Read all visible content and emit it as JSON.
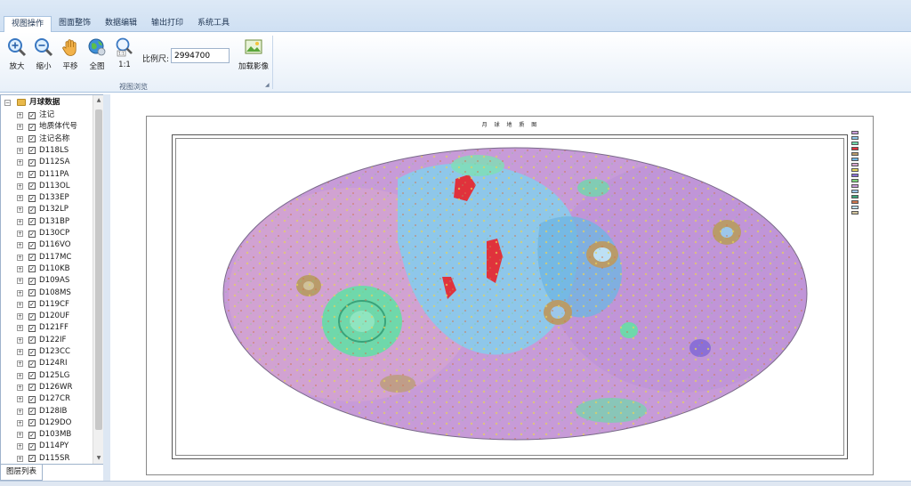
{
  "tabs": [
    "视图操作",
    "图面整饰",
    "数据编辑",
    "输出打印",
    "系统工具"
  ],
  "active_tab": 0,
  "ribbon": {
    "buttons": [
      {
        "label": "放大",
        "icon": "zoom-in-icon"
      },
      {
        "label": "缩小",
        "icon": "zoom-out-icon"
      },
      {
        "label": "平移",
        "icon": "pan-hand-icon"
      },
      {
        "label": "全图",
        "icon": "full-extent-globe-icon"
      },
      {
        "label": "1:1",
        "icon": "actual-size-icon"
      },
      {
        "label": "加载影像",
        "icon": "load-image-icon"
      }
    ],
    "scale_label": "比例尺:",
    "scale_value": "2994700",
    "group_label": "视图浏览"
  },
  "layers": {
    "root": "月球数据",
    "items": [
      "注记",
      "地质体代号",
      "注记名称",
      "D118LS",
      "D112SA",
      "D111PA",
      "D113OL",
      "D133EP",
      "D132LP",
      "D131BP",
      "D130CP",
      "D116VO",
      "D117MC",
      "D110KB",
      "D109AS",
      "D108MS",
      "D119CF",
      "D120UF",
      "D121FF",
      "D122IF",
      "D123CC",
      "D124RI",
      "D125LG",
      "D126WR",
      "D127CR",
      "D128IB",
      "D129DO",
      "D103MB",
      "D114PY",
      "D115SR"
    ]
  },
  "bottom_tab": "图层列表",
  "map": {
    "title": "月 球 地 质 图",
    "colors": {
      "highland": "#c69ad6",
      "mare": "#8ec7ea",
      "basin": "#6fd8ab",
      "red_units": "#e0323c",
      "crater_rim": "#b99b6a"
    }
  }
}
